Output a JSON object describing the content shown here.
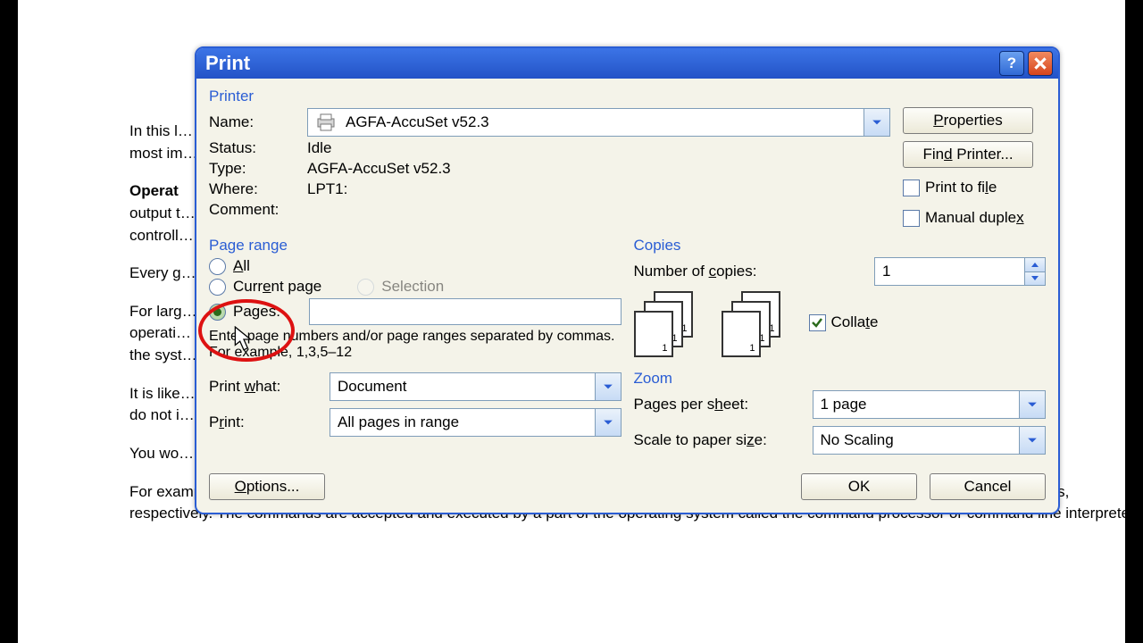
{
  "doc": {
    "p1": "In this l…                                                                                                                                                                                          ms th",
    "p1b": "most im…",
    "h1": "Operat",
    "p2a": "output t…",
    "p2b": "controll…",
    "p3": "Every g…",
    "p4a": "For larg…",
    "p4b": "operati…",
    "p4c": "the syst…",
    "p5a": "It is like…",
    "p5b": "do not i…",
    "p6": "You wo…",
    "p7": "For example, the DOS operating system you give commands such as COPY and RENAME fo copying files and changing the names of files, respectively. The commands are accepted and executed by a part of the operating system called the command processor or command line interpreter."
  },
  "dialog": {
    "title": "Print",
    "printer": {
      "legend": "Printer",
      "name_label": "Name:",
      "name_value": "AGFA-AccuSet v52.3",
      "status_label": "Status:",
      "status_value": "Idle",
      "type_label": "Type:",
      "type_value": "AGFA-AccuSet v52.3",
      "where_label": "Where:",
      "where_value": "LPT1:",
      "comment_label": "Comment:",
      "comment_value": "",
      "properties": "Properties",
      "find_printer": "Find Printer...",
      "print_to_file": "Print to file",
      "manual_duplex": "Manual duplex"
    },
    "page_range": {
      "legend": "Page range",
      "all": "All",
      "current": "Current page",
      "selection": "Selection",
      "pages": "Pages:",
      "hint": "Enter page numbers and/or page ranges separated by commas.  For example, 1,3,5–12"
    },
    "copies": {
      "legend": "Copies",
      "num_label": "Number of copies:",
      "num_value": "1",
      "collate": "Collate"
    },
    "print_what_label": "Print what:",
    "print_what_value": "Document",
    "print_label": "Print:",
    "print_value": "All pages in range",
    "zoom": {
      "legend": "Zoom",
      "pps_label": "Pages per sheet:",
      "pps_value": "1 page",
      "scale_label": "Scale to paper size:",
      "scale_value": "No Scaling"
    },
    "options": "Options...",
    "ok": "OK",
    "cancel": "Cancel"
  }
}
